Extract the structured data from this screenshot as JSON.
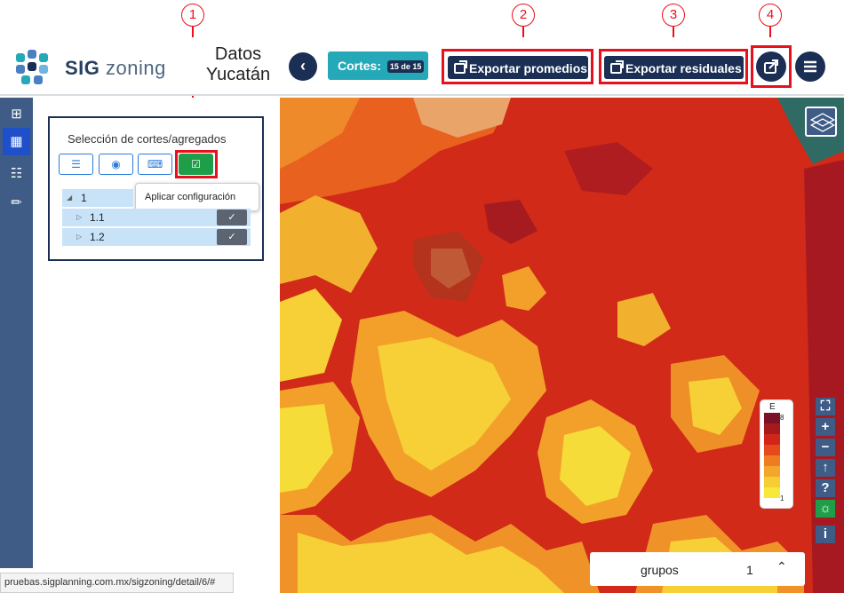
{
  "annotations": {
    "c1": "1",
    "c2": "2",
    "c3": "3",
    "c4": "4"
  },
  "header": {
    "brand_bold": "SIG",
    "brand_rest": "zoning",
    "title": "Datos Yucatán",
    "back_icon": "chevron-left-icon",
    "cortes_label": "Cortes:",
    "cortes_badge": "15 de 15",
    "export_averages_label": "Exportar promedios",
    "export_residuals_label": "Exportar residuales",
    "share_icon": "share-icon",
    "menu_icon": "hamburger-menu-icon"
  },
  "toolbar": {
    "items": [
      {
        "icon": "resize-icon"
      },
      {
        "icon": "columns-icon",
        "active": true
      },
      {
        "icon": "network-icon"
      },
      {
        "icon": "brush-icon"
      }
    ]
  },
  "panel": {
    "title": "Selección de cortes/agregados",
    "buttons": [
      {
        "icon": "list-icon"
      },
      {
        "icon": "globe-icon"
      },
      {
        "icon": "tree-icon"
      },
      {
        "icon": "check-square-icon",
        "state": "active"
      }
    ],
    "tooltip": "Aplicar configuración",
    "tree": [
      {
        "label": "1",
        "expanded": true
      },
      {
        "label": "1.1",
        "expanded": false
      },
      {
        "label": "1.2",
        "expanded": false
      }
    ]
  },
  "status_url": "pruebas.sigplanning.com.mx/sigzoning/detail/6/#",
  "map": {
    "layers_icon": "layers-icon",
    "legend_title": "E",
    "legend_max": "8",
    "legend_min": "1",
    "legend_colors": [
      "#7a1326",
      "#a8191e",
      "#d2251a",
      "#e8491b",
      "#ee7d22",
      "#f3a52c",
      "#f7cd34",
      "#f7e93c"
    ],
    "controls": [
      "fullscreen-icon",
      "zoom-in-icon",
      "zoom-out-icon",
      "north-arrow-icon",
      "help-icon",
      "eye-off-icon",
      "info-icon"
    ],
    "groups_label": "grupos",
    "groups_value": "1",
    "groups_icon": "chevron-up-icon"
  },
  "colors": {
    "navy": "#1b2f55",
    "teal": "#25a9b9",
    "highlight": "#e8101c",
    "green": "#1e9e49"
  }
}
